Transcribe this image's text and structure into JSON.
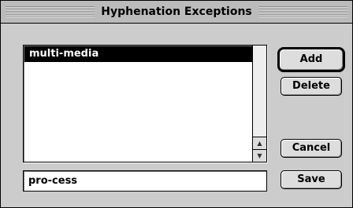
{
  "dialog": {
    "title": "Hyphenation Exceptions"
  },
  "list": {
    "items": [
      {
        "label": "multi-media",
        "selected": true
      }
    ]
  },
  "input": {
    "value": "pro-cess"
  },
  "buttons": {
    "add": "Add",
    "delete": "Delete",
    "cancel": "Cancel",
    "save": "Save"
  },
  "icons": {
    "scroll_up": "arrow-up-icon",
    "scroll_down": "arrow-down-icon"
  }
}
